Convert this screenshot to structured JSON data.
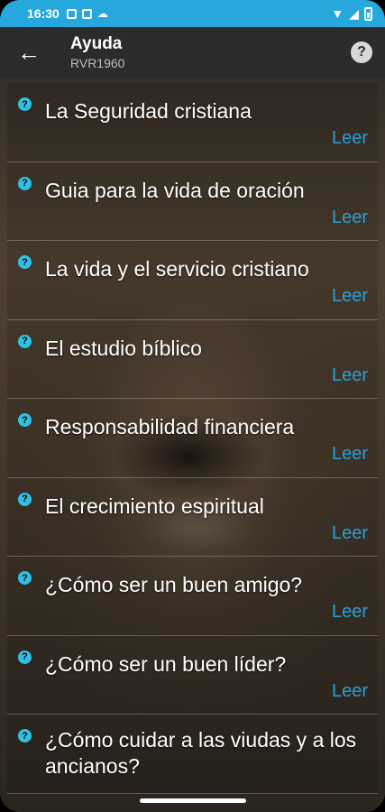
{
  "status_bar": {
    "time": "16:30",
    "icons": [
      "sim-icon",
      "calendar-icon",
      "cloud-icon",
      "wifi-icon",
      "signal-icon",
      "battery-icon"
    ]
  },
  "toolbar": {
    "title": "Ayuda",
    "subtitle": "RVR1960",
    "back_icon": "arrow-back-icon",
    "help_icon": "help-icon"
  },
  "colors": {
    "status_bar": "#26a8dc",
    "toolbar": "#2b2b2b",
    "accent": "#2ec1e6",
    "link": "#2a9fd6"
  },
  "items": [
    {
      "title": "La Seguridad cristiana",
      "action": "Leer"
    },
    {
      "title": "Guia para la vida de oración",
      "action": "Leer"
    },
    {
      "title": "La vida y el servicio cristiano",
      "action": "Leer"
    },
    {
      "title": "El estudio bíblico",
      "action": "Leer"
    },
    {
      "title": "Responsabilidad financiera",
      "action": "Leer"
    },
    {
      "title": "El crecimiento espiritual",
      "action": "Leer"
    },
    {
      "title": "¿Cómo ser un buen amigo?",
      "action": "Leer"
    },
    {
      "title": "¿Cómo ser un buen líder?",
      "action": "Leer"
    },
    {
      "title": "¿Cómo cuidar a las viudas y a los ancianos?",
      "action": ""
    }
  ]
}
